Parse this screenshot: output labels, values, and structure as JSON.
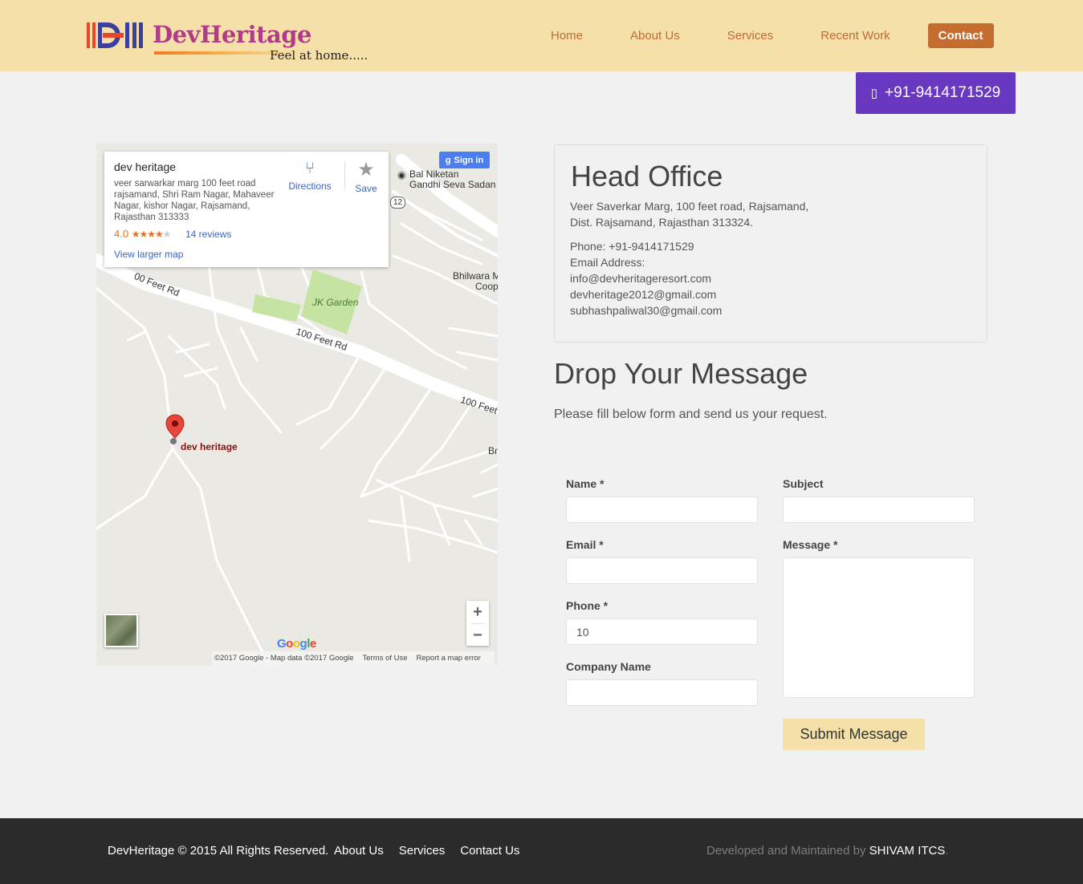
{
  "brand": {
    "name": "DevHeritage",
    "tagline": "Feel at home....."
  },
  "nav": [
    {
      "label": "Home"
    },
    {
      "label": "About Us"
    },
    {
      "label": "Services"
    },
    {
      "label": "Recent Work"
    },
    {
      "label": "Contact"
    }
  ],
  "phone_button": {
    "icon": "mobile-phone-icon",
    "label": "+91-9414171529"
  },
  "map": {
    "card": {
      "title": "dev heritage",
      "address": "veer sarwarkar marg 100 feet road rajsamand, Shri Ram Nagar, Mahaveer Nagar, kishor Nagar, Rajsamand, Rajasthan 313333",
      "rating": "4.0",
      "stars": "★★★★",
      "star_empty": "★",
      "reviews": "14 reviews",
      "larger_map": "View larger map",
      "directions": "Directions",
      "save": "Save"
    },
    "signin": "Sign in",
    "labels": {
      "bal_niketan_1": "Bal Niketan",
      "bal_niketan_2": "Gandhi Seva Sadan",
      "route_badge": "12",
      "bhilwara_1": "Bhilwara M",
      "bhilwara_2": "Coop",
      "jk_garden": "JK Garden",
      "road_a": "00 Feet Rd",
      "road_b": "100 Feet Rd",
      "road_c": "100 Feet",
      "br": "Br",
      "pin": "dev heritage"
    },
    "zoom_in": "+",
    "zoom_out": "−",
    "google": [
      "G",
      "o",
      "o",
      "g",
      "l",
      "e"
    ],
    "footer": {
      "data": "©2017 Google - Map data ©2017 Google",
      "terms": "Terms of Use",
      "report": "Report a map error"
    }
  },
  "office": {
    "title": "Head Office",
    "address_line1": "Veer Saverkar Marg, 100 feet road, Rajsamand,",
    "address_line2": "Dist. Rajsamand, Rajasthan 313324.",
    "phone": "Phone: +91-9414171529",
    "email_label": "Email Address:",
    "emails": [
      "info@devheritageresort.com",
      "devheritage2012@gmail.com",
      "subhashpaliwal30@gmail.com"
    ]
  },
  "message": {
    "title": "Drop Your Message",
    "subtitle": "Please fill below form and send us your request."
  },
  "form": {
    "name_label": "Name *",
    "subject_label": "Subject",
    "email_label": "Email *",
    "message_label": "Message *",
    "phone_label": "Phone *",
    "phone_value": "10",
    "company_label": "Company Name",
    "submit": "Submit Message"
  },
  "footer": {
    "copyright": "DevHeritage © 2015 All Rights Reserved.",
    "links": [
      "About Us",
      "Services",
      "Contact Us"
    ],
    "developed_prefix": "Developed and Maintained by",
    "developer": "SHIVAM ITCS",
    "period": "."
  }
}
